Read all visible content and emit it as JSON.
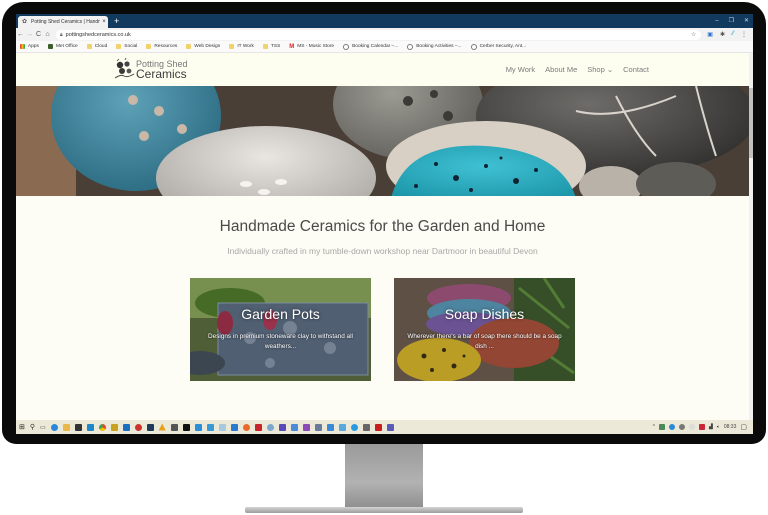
{
  "browser": {
    "tab_title": "Potting Shed Ceramics | Handma",
    "tab_close": "×",
    "new_tab": "+",
    "window_controls": [
      "–",
      "❐",
      "✕"
    ],
    "url": "pottingshedceramics.co.uk",
    "nav": {
      "back": "←",
      "forward": "→",
      "reload": "C",
      "home": "⌂"
    },
    "bookmarks": [
      {
        "label": "Apps",
        "icon": "apps-grid-icon"
      },
      {
        "label": "Met Office",
        "icon": "met-office-icon"
      },
      {
        "label": "Cloud",
        "icon": "folder-icon"
      },
      {
        "label": "Social",
        "icon": "folder-icon"
      },
      {
        "label": "Resources",
        "icon": "folder-icon"
      },
      {
        "label": "Web Design",
        "icon": "folder-icon"
      },
      {
        "label": "IT Work",
        "icon": "folder-icon"
      },
      {
        "label": "TSS",
        "icon": "folder-icon"
      },
      {
        "label": "MS - Music Store",
        "icon": "ms-icon"
      },
      {
        "label": "Booking Calendar –...",
        "icon": "wordpress-icon"
      },
      {
        "label": "Booking Activities –...",
        "icon": "wordpress-icon"
      },
      {
        "label": "Cerber Security, Ant...",
        "icon": "wordpress-icon"
      }
    ]
  },
  "site": {
    "logo": {
      "line1": "Potting Shed",
      "line2": "Ceramics"
    },
    "nav": [
      "My Work",
      "About Me",
      "Shop ⌄",
      "Contact"
    ],
    "headline": "Handmade Ceramics for the Garden and Home",
    "subheadline": "Individually crafted in my tumble-down workshop near Dartmoor in beautiful Devon",
    "cards": [
      {
        "title": "Garden Pots",
        "description": "Designs in premium stoneware clay to withstand all weathers..."
      },
      {
        "title": "Soap Dishes",
        "description": "Wherever there's a bar of soap there should be a soap dish ..."
      }
    ]
  },
  "taskbar": {
    "clock": "08:33",
    "tray_chevron": "^"
  },
  "colors": {
    "tab_bar": "#123a5e",
    "site_bg": "#fdfdf5",
    "nav_text": "#7c7c7c"
  }
}
